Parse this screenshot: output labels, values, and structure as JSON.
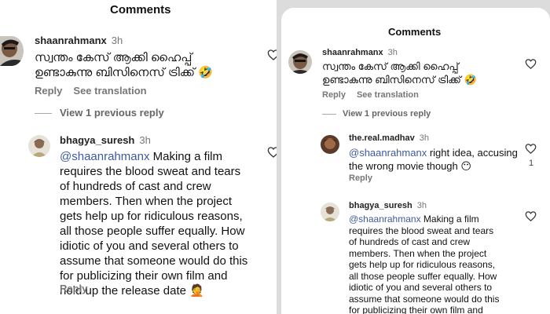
{
  "left": {
    "header": "Comments",
    "comment1": {
      "username": "shaanrahmanx",
      "time": "3h",
      "text_line1": "സ്വന്തം കേസ് ആക്കി ഹൈപ്പ്",
      "text_line2": "ഉണ്ടാകുന്നു ബിസിനെസ് ട്രിക്ക് 🤣",
      "reply_label": "Reply",
      "translate_label": "See translation"
    },
    "view_replies": "View 1 previous reply",
    "comment2": {
      "username": "bhagya_suresh",
      "time": "3h",
      "mention": "@shaanrahmanx",
      "lines": [
        " Making a film",
        "requires the blood sweat and tears",
        "of hundreds of cast and crew",
        "members. Then when the project",
        "gets help up for ridiculous reasons,",
        "all those people suffer equally. How",
        "idiotic of you and several others to",
        "assume that someone would do this",
        "for publicizing their own film and",
        "hold up the release date 🤦"
      ],
      "reply_label": "Reply"
    }
  },
  "right": {
    "header": "Comments",
    "comment1": {
      "username": "shaanrahmanx",
      "time": "3h",
      "text_line1": "സ്വന്തം കേസ് ആക്കി ഹൈപ്പ്",
      "text_line2": "ഉണ്ടാകുന്നു ബിസിനെസ് ട്രിക്ക് 🤣",
      "reply_label": "Reply",
      "translate_label": "See translation"
    },
    "view_replies": "View 1 previous reply",
    "comment2": {
      "username": "the.real.madhav",
      "time": "3h",
      "mention": "@shaanrahmanx",
      "line1_rest": " right idea, accusing",
      "line2": "the wrong movie though 😶",
      "reply_label": "Reply",
      "like_count": "1"
    },
    "comment3": {
      "username": "bhagya_suresh",
      "time": "3h",
      "mention": "@shaanrahmanx",
      "lines": [
        " Making a film",
        "requires the blood sweat and tears",
        "of hundreds of cast and crew",
        "members. Then when the project",
        "gets help up for ridiculous reasons,",
        "all those people suffer equally. How",
        "idiotic of you and several others to",
        "assume that someone would do this",
        "for publicizing their own film and"
      ]
    }
  }
}
